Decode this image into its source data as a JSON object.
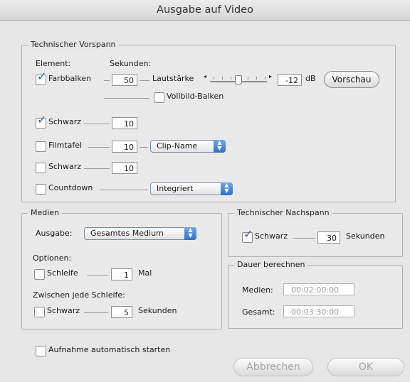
{
  "window": {
    "title": "Ausgabe auf Video"
  },
  "vorspann": {
    "title": "Technischer Vorspann",
    "col_element": "Element:",
    "col_sekunden": "Sekunden:",
    "farbbalken": {
      "label": "Farbbalken",
      "checked": true,
      "seconds": "50"
    },
    "lautstaerke_label": "Lautstärke",
    "volume_value": "-12",
    "volume_unit": "dB",
    "vorschau_label": "Vorschau",
    "vollbild": {
      "label": "Vollbild-Balken",
      "checked": false
    },
    "schwarz1": {
      "label": "Schwarz",
      "checked": true,
      "seconds": "10"
    },
    "filmtafel": {
      "label": "Filmtafel",
      "checked": false,
      "seconds": "10",
      "popup": "Clip-Name"
    },
    "schwarz2": {
      "label": "Schwarz",
      "checked": false,
      "seconds": "10"
    },
    "countdown": {
      "label": "Countdown",
      "checked": false,
      "popup": "Integriert"
    }
  },
  "medien": {
    "title": "Medien",
    "ausgabe_label": "Ausgabe:",
    "ausgabe_value": "Gesamtes Medium",
    "optionen_label": "Optionen:",
    "schleife": {
      "label": "Schleife",
      "checked": false,
      "value": "1",
      "unit": "Mal"
    },
    "zwischen_label": "Zwischen jede Schleife:",
    "schwarz": {
      "label": "Schwarz",
      "checked": false,
      "value": "5",
      "unit": "Sekunden"
    }
  },
  "nachspann": {
    "title": "Technischer Nachspann",
    "schwarz": {
      "label": "Schwarz",
      "checked": true,
      "value": "30",
      "unit": "Sekunden"
    }
  },
  "dauer": {
    "title": "Dauer berechnen",
    "medien_label": "Medien:",
    "medien_value": "00:02:00:00",
    "gesamt_label": "Gesamt:",
    "gesamt_value": "00:03:30:00"
  },
  "footer": {
    "aufnahme_label": "Aufnahme automatisch starten",
    "aufnahme_checked": false,
    "cancel_label": "Abbrechen",
    "ok_label": "OK"
  },
  "colors": {
    "accent": "#2f6fcf",
    "check": "#1f5fb8"
  }
}
